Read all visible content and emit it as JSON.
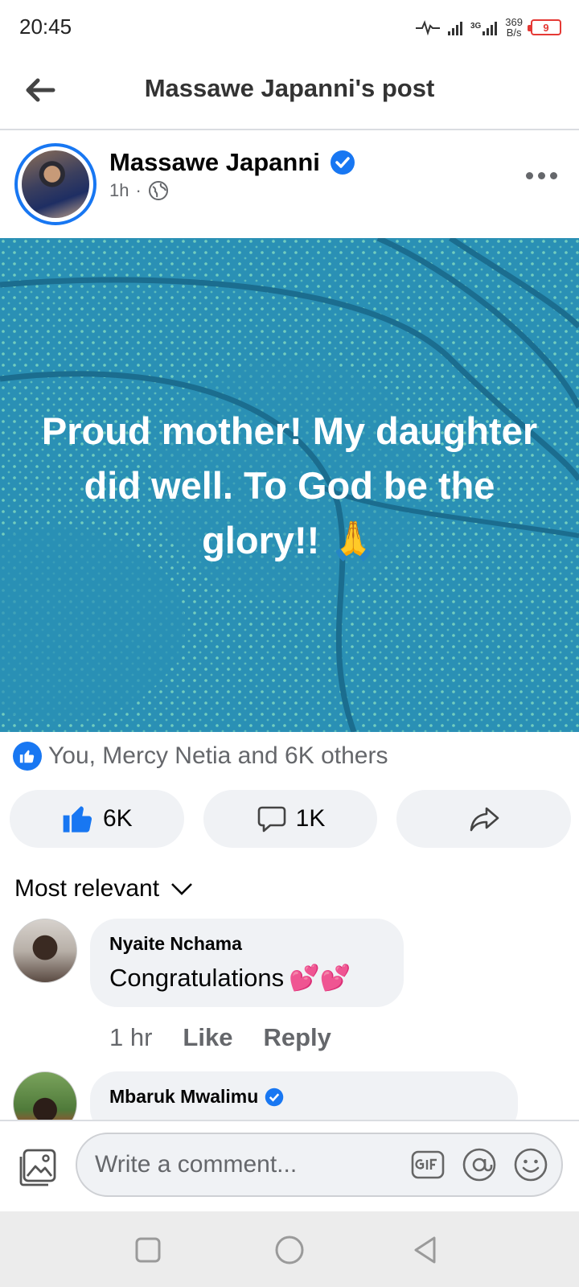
{
  "status_bar": {
    "time": "20:45",
    "network_type": "3G",
    "speed_value": "369",
    "speed_unit": "B/s",
    "battery": "9"
  },
  "header": {
    "title": "Massawe Japanni's post"
  },
  "post": {
    "author": "Massawe Japanni",
    "time": "1h",
    "separator": "·",
    "text_line1": "Proud mother! My daughter",
    "text_line2": "did well. To God be the",
    "text_line3": "glory!!",
    "emoji": "🙏",
    "background_color": "#2a90b5",
    "reactions_summary": "You, Mercy Netia and 6K others",
    "like_count": "6K",
    "comment_count": "1K"
  },
  "comments": {
    "sort_label": "Most relevant",
    "items": [
      {
        "name": "Nyaite Nchama",
        "text": "Congratulations",
        "emoji": "💕💕",
        "time": "1 hr",
        "like_label": "Like",
        "reply_label": "Reply"
      },
      {
        "name": "Mbaruk Mwalimu"
      }
    ]
  },
  "composer": {
    "placeholder": "Write a comment..."
  },
  "colors": {
    "accent": "#1877f2",
    "muted": "#65676b",
    "bubble": "#f0f2f5"
  }
}
